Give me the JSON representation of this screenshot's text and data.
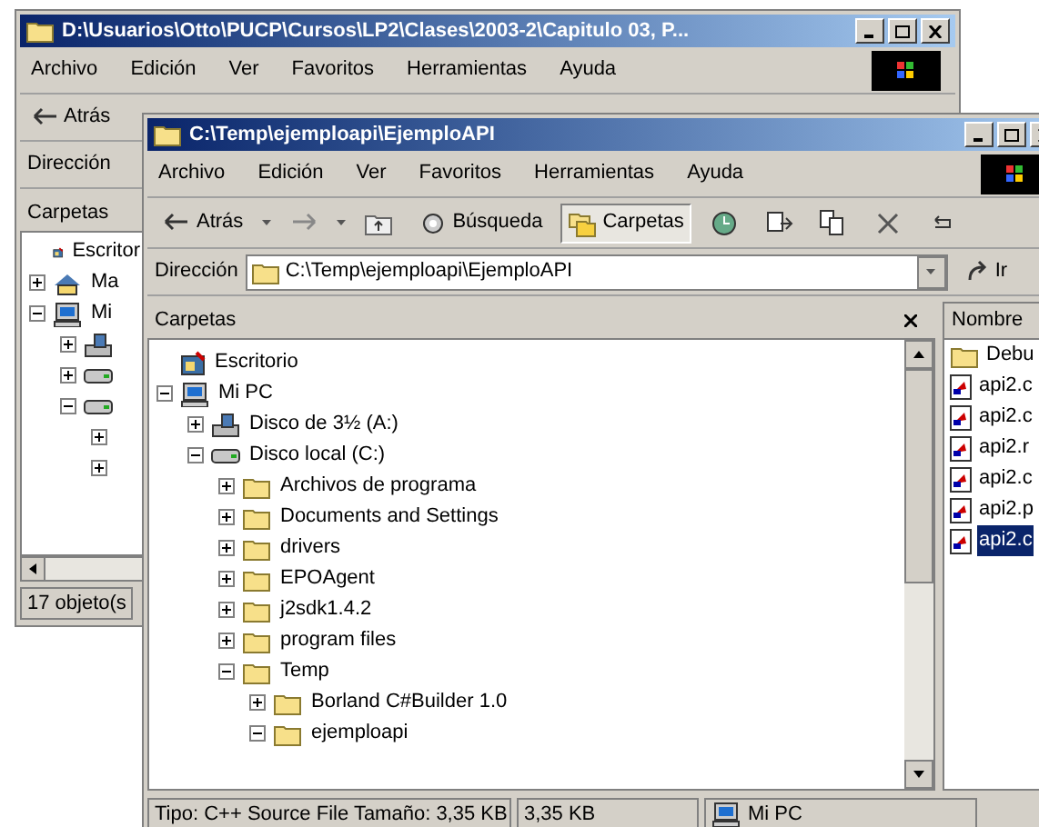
{
  "back_window": {
    "title": "D:\\Usuarios\\Otto\\PUCP\\Cursos\\LP2\\Clases\\2003-2\\Capitulo 03, P...",
    "menu": [
      "Archivo",
      "Edición",
      "Ver",
      "Favoritos",
      "Herramientas",
      "Ayuda"
    ],
    "toolbar": [
      {
        "kind": "back",
        "label": "Atrás"
      }
    ],
    "address_label": "Dirección",
    "pane_title": "Carpetas",
    "tree": [
      {
        "kind": "desktop",
        "label": "Escritor"
      },
      {
        "kind": "network",
        "label": "Ma",
        "expanded": false
      },
      {
        "kind": "computer",
        "label": "Mi",
        "expanded": true,
        "children": [
          {
            "kind": "floppy",
            "expanded": false
          },
          {
            "kind": "drive",
            "expanded": false
          },
          {
            "kind": "drive",
            "expanded": true,
            "children": [
              {
                "expanded": false
              },
              {
                "expanded": false
              }
            ]
          }
        ]
      }
    ],
    "status": "17 objeto(s"
  },
  "front_window": {
    "title": "C:\\Temp\\ejemploapi\\EjemploAPI",
    "menu": [
      "Archivo",
      "Edición",
      "Ver",
      "Favoritos",
      "Herramientas",
      "Ayuda"
    ],
    "toolbar": [
      {
        "kind": "back",
        "label": "Atrás",
        "pressed": false
      },
      {
        "kind": "forward",
        "pressed": false
      },
      {
        "kind": "up",
        "pressed": false
      },
      {
        "kind": "search",
        "label": "Búsqueda",
        "pressed": false
      },
      {
        "kind": "folders",
        "label": "Carpetas",
        "pressed": true
      },
      {
        "kind": "history",
        "pressed": false
      },
      {
        "kind": "move",
        "pressed": false
      },
      {
        "kind": "copy",
        "pressed": false
      },
      {
        "kind": "delete",
        "pressed": false
      },
      {
        "kind": "undo",
        "pressed": false
      }
    ],
    "address_label": "Dirección",
    "address": "C:\\Temp\\ejemploapi\\EjemploAPI",
    "go_label": "Ir",
    "pane_title": "Carpetas",
    "tree": [
      {
        "kind": "desktop",
        "label": "Escritorio"
      },
      {
        "kind": "computer",
        "label": "Mi PC",
        "expanded": true,
        "children": [
          {
            "kind": "floppy",
            "label": "Disco de 3½ (A:)",
            "expanded": false
          },
          {
            "kind": "drive",
            "label": "Disco local (C:)",
            "expanded": true,
            "children": [
              {
                "kind": "folder",
                "label": "Archivos de programa",
                "expanded": false
              },
              {
                "kind": "folder",
                "label": "Documents and Settings",
                "expanded": false
              },
              {
                "kind": "folder",
                "label": "drivers",
                "expanded": false
              },
              {
                "kind": "folder",
                "label": "EPOAgent",
                "expanded": false
              },
              {
                "kind": "folder",
                "label": "j2sdk1.4.2",
                "expanded": false
              },
              {
                "kind": "folder",
                "label": "program files",
                "expanded": false
              },
              {
                "kind": "folder",
                "label": "Temp",
                "expanded": true,
                "children": [
                  {
                    "kind": "folder",
                    "label": "Borland C#Builder 1.0",
                    "expanded": false
                  },
                  {
                    "kind": "folder",
                    "label": "ejemploapi",
                    "expanded": true
                  }
                ]
              }
            ]
          }
        ]
      }
    ],
    "list_header": "Nombre",
    "files": [
      {
        "kind": "folder",
        "name": "Debu",
        "selected": false
      },
      {
        "kind": "file",
        "name": "api2.c",
        "selected": false
      },
      {
        "kind": "file",
        "name": "api2.c",
        "selected": false
      },
      {
        "kind": "file",
        "name": "api2.r",
        "selected": false
      },
      {
        "kind": "file",
        "name": "api2.c",
        "selected": false
      },
      {
        "kind": "file",
        "name": "api2.p",
        "selected": false
      },
      {
        "kind": "file",
        "name": "api2.c",
        "selected": true
      }
    ],
    "status": [
      "Tipo: C++ Source File Tamaño: 3,35 KB",
      "3,35 KB",
      "Mi PC"
    ]
  }
}
